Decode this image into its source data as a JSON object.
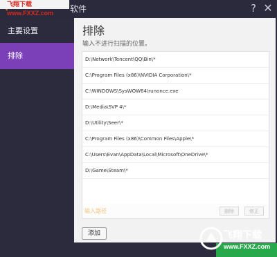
{
  "window": {
    "title_suffix": "软件",
    "help_glyph": "?",
    "close_glyph": "✕",
    "watermark": "飞翔下载 www.FXXZ.com"
  },
  "sidebar": {
    "items": [
      {
        "label": "主要设置",
        "active": false
      },
      {
        "label": "排除",
        "active": true
      }
    ],
    "active_color": "#7b3fb8"
  },
  "panel": {
    "title": "排除",
    "subtitle": "输入不进行扫描的位置。",
    "paths": [
      "D:\\Network\\Tencent\\QQ\\Bin\\*",
      "C:\\Program Files (x86)\\NVIDIA Corporation\\*",
      "C:\\WINDOWS\\SysWOW64\\runonce.exe",
      "D:\\Media\\SVP 4\\*",
      "D:\\Utility\\Seer\\*",
      "C:\\Program Files (x86)\\Common Files\\Apple\\*",
      "C:\\Users\\Evan\\AppData\\Local\\Microsoft\\OneDrive\\*",
      "D:\\Game\\Steam\\*"
    ],
    "input_placeholder": "输入路径",
    "delete_label": "删除",
    "modify_label": "修正",
    "add_label": "添加"
  },
  "watermark_bottom": {
    "brand": "飞翔下载",
    "url": "www.FXXZ.com"
  }
}
